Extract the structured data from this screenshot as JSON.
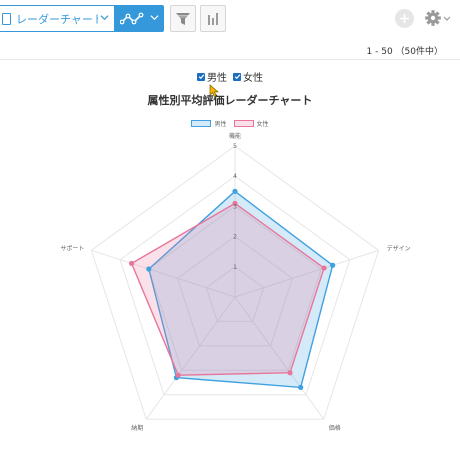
{
  "toolbar": {
    "view_label": "レーダーチャート（…",
    "view_icon": "document-icon",
    "chart_type_icon": "line-chart-icon",
    "filter_icon": "filter-icon",
    "bar_icon": "bar-chart-icon",
    "add_icon": "plus-icon",
    "settings_icon": "gear-icon"
  },
  "pagination": "1 - 50 （50件中）",
  "filters": [
    {
      "label": "男性",
      "checked": true
    },
    {
      "label": "女性",
      "checked": true
    }
  ],
  "colors": {
    "accent": "#3498db",
    "male": "#3fa1e0",
    "female": "#e8769a"
  },
  "chart_data": {
    "type": "radar",
    "title": "属性別平均評価レーダーチャート",
    "axes": [
      "機能",
      "デザイン",
      "価格",
      "納期",
      "サポート"
    ],
    "ticks": [
      "1",
      "2",
      "3",
      "4",
      "5"
    ],
    "range": [
      0,
      5
    ],
    "legend_position": "top",
    "series": [
      {
        "name": "男性",
        "values": [
          3.5,
          3.4,
          3.7,
          3.3,
          3.0
        ]
      },
      {
        "name": "女性",
        "values": [
          3.1,
          3.1,
          3.1,
          3.2,
          3.6
        ]
      }
    ]
  }
}
